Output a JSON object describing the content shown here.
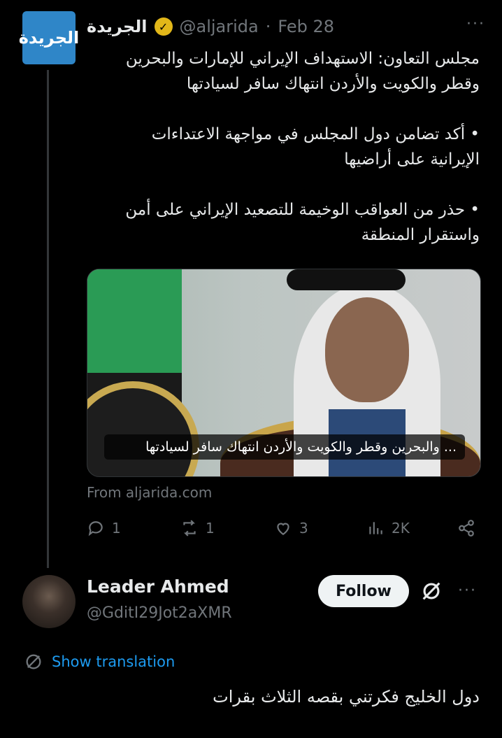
{
  "tweet": {
    "display_name": "الجريدة",
    "handle": "@aljarida",
    "separator": "·",
    "date": "Feb 28",
    "more": "···",
    "logo_text": "الجريدة",
    "text": "مجلس التعاون: الاستهداف الإيراني للإمارات والبحرين\nوقطر والكويت والأردن انتهاك سافر لسيادتها\n\n• أكد تضامن دول المجلس في مواجهة الاعتداءات\nالإيرانية على أراضيها\n\n• حذر من العواقب الوخيمة للتصعيد الإيراني على أمن\nواستقرار المنطقة",
    "card": {
      "caption": "... والبحرين وقطر والكويت والأردن انتهاك سافر لسيادتها",
      "from": "From aljarida.com"
    },
    "actions": {
      "replies": "1",
      "reposts": "1",
      "likes": "3",
      "views": "2K"
    }
  },
  "reply": {
    "display_name": "Leader Ahmed",
    "handle": "@GditI29Jot2aXMR",
    "follow_label": "Follow",
    "more": "···",
    "show_translation": "Show translation",
    "text": "دول الخليج فكرتني بقصه الثلاث بقرات"
  },
  "colors": {
    "background": "#000000",
    "text": "#e7e9ea",
    "muted": "#71767b",
    "link": "#1d9bf0",
    "verified": "#e2b719",
    "logo_bg": "#2f86c8"
  }
}
